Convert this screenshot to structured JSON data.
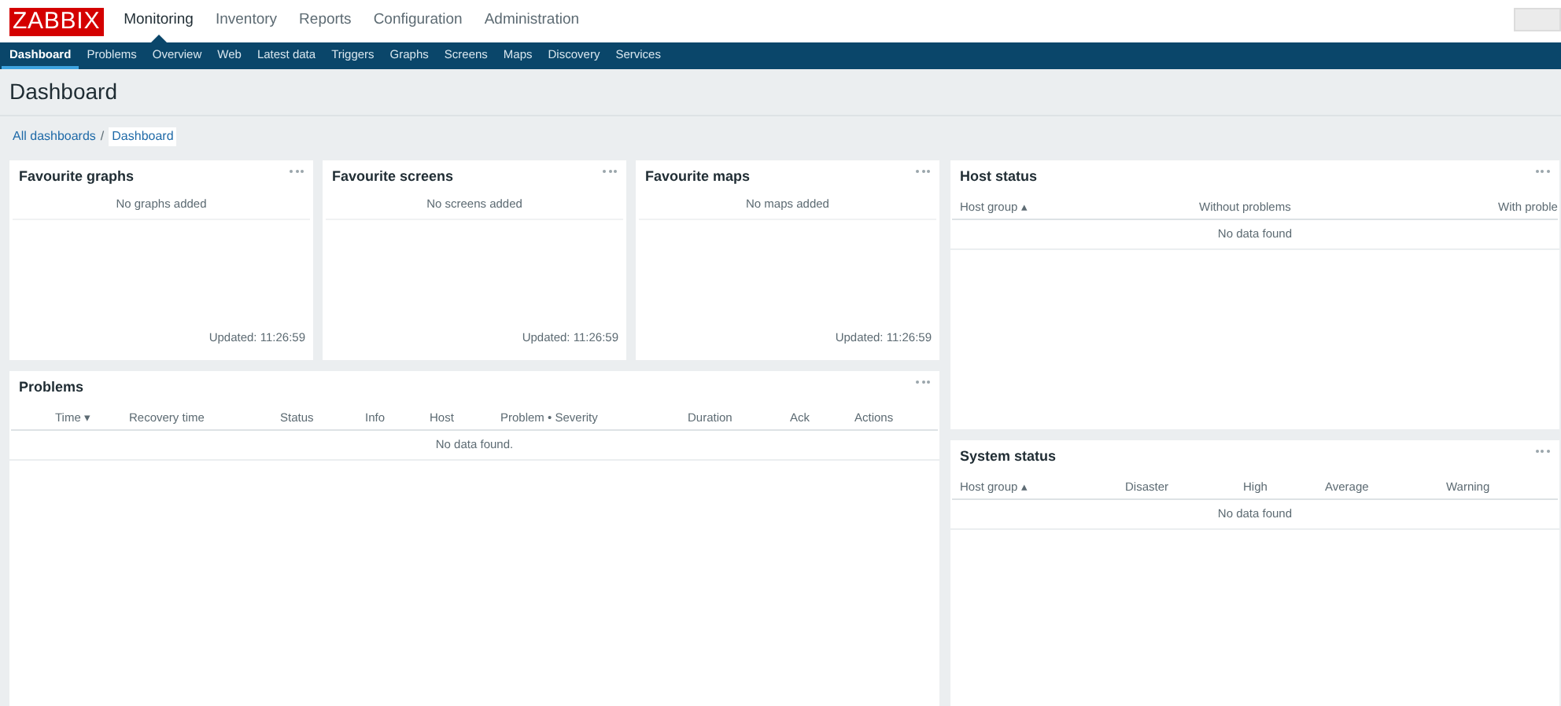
{
  "logo": "ZABBIX",
  "main_menu": [
    {
      "label": "Monitoring",
      "selected": true
    },
    {
      "label": "Inventory",
      "selected": false
    },
    {
      "label": "Reports",
      "selected": false
    },
    {
      "label": "Configuration",
      "selected": false
    },
    {
      "label": "Administration",
      "selected": false
    }
  ],
  "sub_menu": [
    {
      "label": "Dashboard",
      "selected": true
    },
    {
      "label": "Problems",
      "selected": false
    },
    {
      "label": "Overview",
      "selected": false
    },
    {
      "label": "Web",
      "selected": false
    },
    {
      "label": "Latest data",
      "selected": false
    },
    {
      "label": "Triggers",
      "selected": false
    },
    {
      "label": "Graphs",
      "selected": false
    },
    {
      "label": "Screens",
      "selected": false
    },
    {
      "label": "Maps",
      "selected": false
    },
    {
      "label": "Discovery",
      "selected": false
    },
    {
      "label": "Services",
      "selected": false
    }
  ],
  "page_title": "Dashboard",
  "breadcrumb_separator": "/",
  "breadcrumbs": [
    {
      "label": "All dashboards",
      "selected": false
    },
    {
      "label": "Dashboard",
      "selected": true
    }
  ],
  "favourites": [
    {
      "title": "Favourite graphs",
      "message": "No graphs added",
      "updated": "Updated: 11:26:59"
    },
    {
      "title": "Favourite screens",
      "message": "No screens added",
      "updated": "Updated: 11:26:59"
    },
    {
      "title": "Favourite maps",
      "message": "No maps added",
      "updated": "Updated: 11:26:59"
    }
  ],
  "problems": {
    "title": "Problems",
    "columns": [
      "Time ▾",
      "Recovery time",
      "Status",
      "Info",
      "Host",
      "Problem • Severity",
      "Duration",
      "Ack",
      "Actions"
    ],
    "empty": "No data found."
  },
  "host_status": {
    "title": "Host status",
    "columns": [
      "Host group ▴",
      "Without problems",
      "With proble"
    ],
    "empty": "No data found"
  },
  "system_status": {
    "title": "System status",
    "columns": [
      "Host group ▴",
      "Disaster",
      "High",
      "Average",
      "Warning"
    ],
    "empty": "No data found"
  }
}
